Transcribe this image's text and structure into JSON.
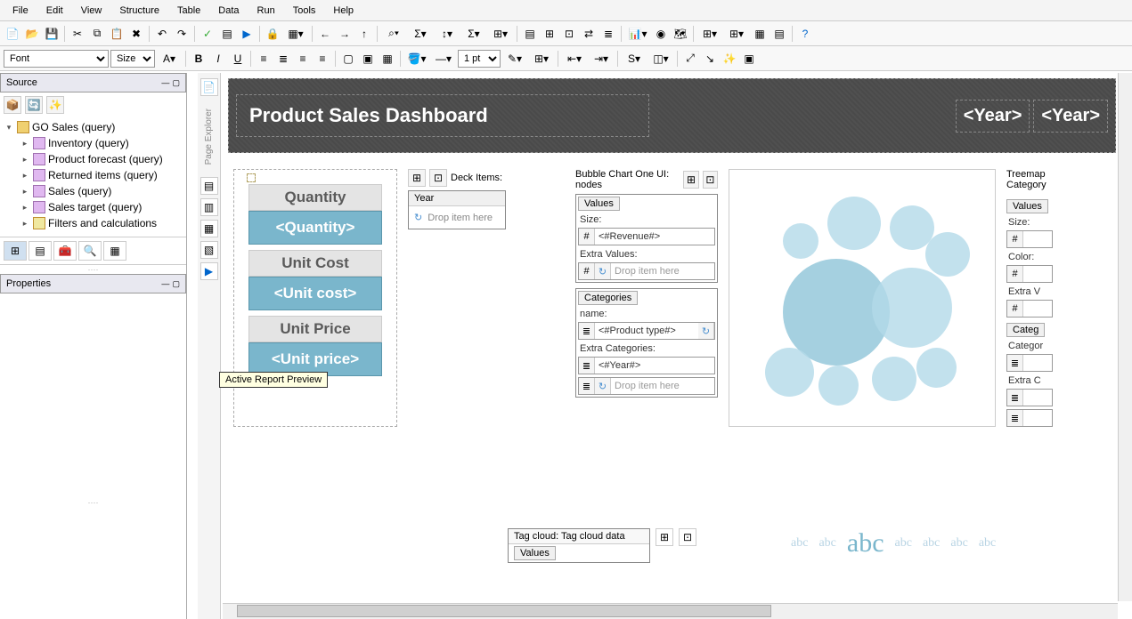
{
  "menu": [
    "File",
    "Edit",
    "View",
    "Structure",
    "Table",
    "Data",
    "Run",
    "Tools",
    "Help"
  ],
  "font_label": "Font",
  "size_label": "Size",
  "pt_label": "1 pt",
  "source_panel": {
    "title": "Source",
    "root": "GO Sales (query)",
    "items": [
      "Inventory (query)",
      "Product forecast (query)",
      "Returned items (query)",
      "Sales (query)",
      "Sales target (query)",
      "Filters and calculations"
    ]
  },
  "properties_panel": {
    "title": "Properties"
  },
  "page_explorer_label": "Page Explorer",
  "tooltip": "Active Report Preview",
  "report": {
    "title": "Product Sales Dashboard",
    "year_cells": [
      "<Year>",
      "<Year>"
    ]
  },
  "cards": {
    "qty_label": "Quantity",
    "qty_val": "<Quantity>",
    "cost_label": "Unit Cost",
    "cost_val": "<Unit cost>",
    "price_label": "Unit Price",
    "price_val": "<Unit price>"
  },
  "deck": {
    "header": "Deck Items:",
    "box_head": "Year",
    "drop": "Drop item here"
  },
  "bubble": {
    "header": "Bubble Chart One UI: nodes",
    "values_tab": "Values",
    "size_label": "Size:",
    "size_field": "<#Revenue#>",
    "extra_values": "Extra Values:",
    "drop": "Drop item here",
    "categories_tab": "Categories",
    "name_label": "name:",
    "name_field": "<#Product type#>",
    "extra_cats": "Extra Categories:",
    "year_field": "<#Year#>",
    "drop2": "Drop item here"
  },
  "treemap": {
    "header": "Treemap",
    "cat_label": "Category",
    "values_tab": "Values",
    "size_label": "Size:",
    "color_label": "Color:",
    "extra_v": "Extra V",
    "cat_tab": "Categ",
    "cat2": "Categor",
    "extra_c": "Extra C"
  },
  "tagcloud": {
    "header": "Tag cloud: Tag cloud data",
    "values_tab": "Values"
  },
  "abc": "abc"
}
